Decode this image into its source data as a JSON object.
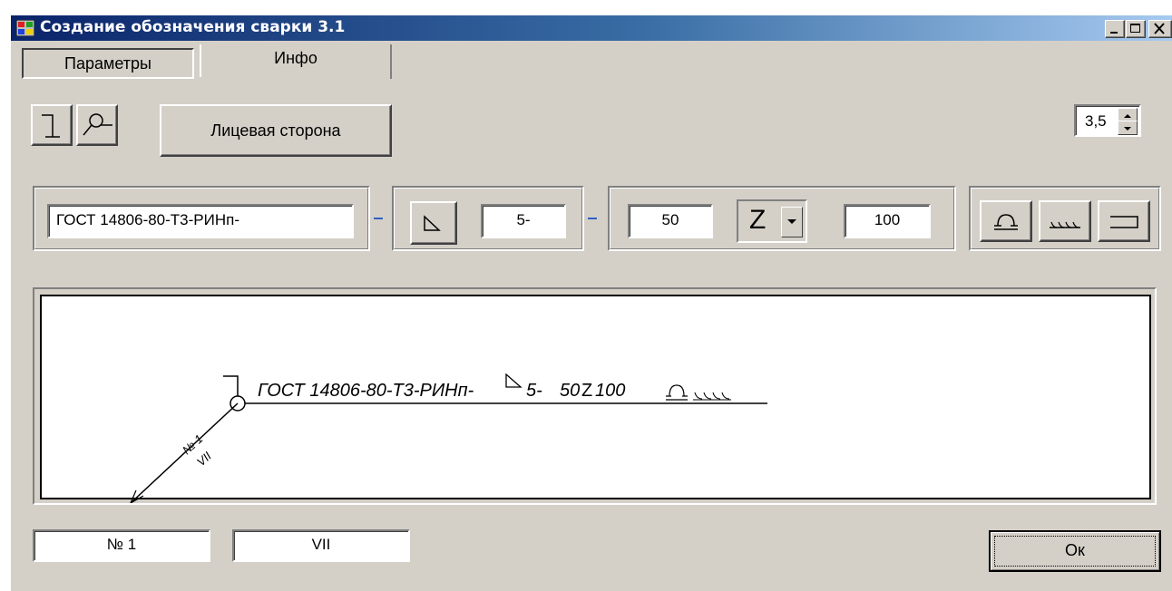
{
  "window": {
    "title": "Создание обозначения сварки 3.1"
  },
  "tabs": [
    {
      "label": "Параметры",
      "active": true
    },
    {
      "label": "Инфо",
      "active": false
    }
  ],
  "toolbar": {
    "face_side_label": "Лицевая сторона",
    "font_size_value": "3,5",
    "icons": [
      "flag-icon",
      "circle-leader-icon"
    ]
  },
  "params": {
    "standard": "ГОСТ 14806-80-Т3-РИНп-",
    "separator": "-",
    "leg": "5-",
    "length": "50",
    "pattern_symbol": "Z",
    "pitch": "100"
  },
  "preview": {
    "designation": "ГОСТ 14806-80-Т3-РИНп-",
    "leg": "5-",
    "length": "50",
    "pattern_symbol": "Z",
    "pitch": "100",
    "number_label": "№ 1",
    "grade_label": "VII"
  },
  "bottom": {
    "number_value": "№ 1",
    "grade_value": "VII",
    "ok_label": "Ок"
  }
}
